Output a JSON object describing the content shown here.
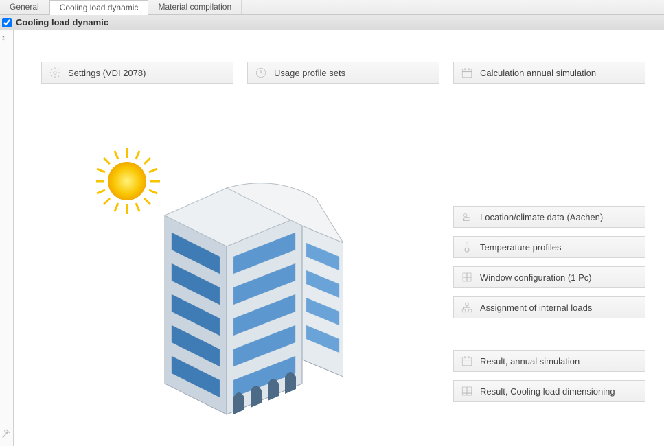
{
  "tabs": {
    "general": "General",
    "cooling": "Cooling load dynamic",
    "material": "Material compilation"
  },
  "panel": {
    "title": "Cooling load dynamic",
    "checked": true
  },
  "buttons": {
    "settings": "Settings (VDI 2078)",
    "usage": "Usage profile sets",
    "calc_annual": "Calculation annual simulation",
    "location": "Location/climate data (Aachen)",
    "temp_profiles": "Temperature profiles",
    "window_cfg": "Window configuration (1 Pc)",
    "assignment": "Assignment of internal loads",
    "result_annual": "Result, annual simulation",
    "result_dimensioning": "Result, Cooling load dimensioning"
  }
}
